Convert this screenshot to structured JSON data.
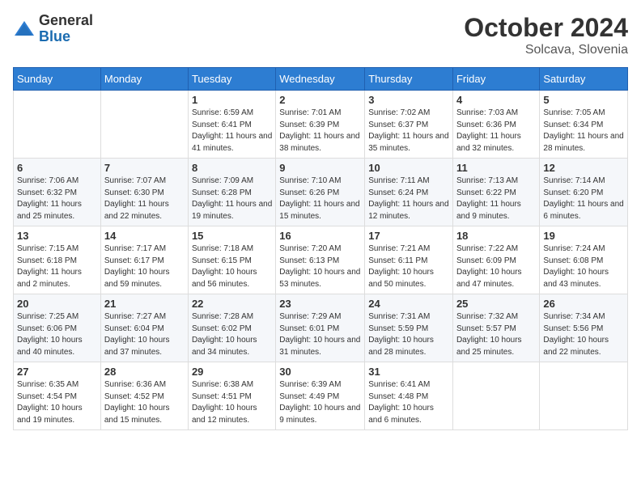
{
  "header": {
    "logo_general": "General",
    "logo_blue": "Blue",
    "month": "October 2024",
    "location": "Solcava, Slovenia"
  },
  "weekdays": [
    "Sunday",
    "Monday",
    "Tuesday",
    "Wednesday",
    "Thursday",
    "Friday",
    "Saturday"
  ],
  "weeks": [
    [
      {
        "day": "",
        "info": ""
      },
      {
        "day": "",
        "info": ""
      },
      {
        "day": "1",
        "info": "Sunrise: 6:59 AM\nSunset: 6:41 PM\nDaylight: 11 hours and 41 minutes."
      },
      {
        "day": "2",
        "info": "Sunrise: 7:01 AM\nSunset: 6:39 PM\nDaylight: 11 hours and 38 minutes."
      },
      {
        "day": "3",
        "info": "Sunrise: 7:02 AM\nSunset: 6:37 PM\nDaylight: 11 hours and 35 minutes."
      },
      {
        "day": "4",
        "info": "Sunrise: 7:03 AM\nSunset: 6:36 PM\nDaylight: 11 hours and 32 minutes."
      },
      {
        "day": "5",
        "info": "Sunrise: 7:05 AM\nSunset: 6:34 PM\nDaylight: 11 hours and 28 minutes."
      }
    ],
    [
      {
        "day": "6",
        "info": "Sunrise: 7:06 AM\nSunset: 6:32 PM\nDaylight: 11 hours and 25 minutes."
      },
      {
        "day": "7",
        "info": "Sunrise: 7:07 AM\nSunset: 6:30 PM\nDaylight: 11 hours and 22 minutes."
      },
      {
        "day": "8",
        "info": "Sunrise: 7:09 AM\nSunset: 6:28 PM\nDaylight: 11 hours and 19 minutes."
      },
      {
        "day": "9",
        "info": "Sunrise: 7:10 AM\nSunset: 6:26 PM\nDaylight: 11 hours and 15 minutes."
      },
      {
        "day": "10",
        "info": "Sunrise: 7:11 AM\nSunset: 6:24 PM\nDaylight: 11 hours and 12 minutes."
      },
      {
        "day": "11",
        "info": "Sunrise: 7:13 AM\nSunset: 6:22 PM\nDaylight: 11 hours and 9 minutes."
      },
      {
        "day": "12",
        "info": "Sunrise: 7:14 AM\nSunset: 6:20 PM\nDaylight: 11 hours and 6 minutes."
      }
    ],
    [
      {
        "day": "13",
        "info": "Sunrise: 7:15 AM\nSunset: 6:18 PM\nDaylight: 11 hours and 2 minutes."
      },
      {
        "day": "14",
        "info": "Sunrise: 7:17 AM\nSunset: 6:17 PM\nDaylight: 10 hours and 59 minutes."
      },
      {
        "day": "15",
        "info": "Sunrise: 7:18 AM\nSunset: 6:15 PM\nDaylight: 10 hours and 56 minutes."
      },
      {
        "day": "16",
        "info": "Sunrise: 7:20 AM\nSunset: 6:13 PM\nDaylight: 10 hours and 53 minutes."
      },
      {
        "day": "17",
        "info": "Sunrise: 7:21 AM\nSunset: 6:11 PM\nDaylight: 10 hours and 50 minutes."
      },
      {
        "day": "18",
        "info": "Sunrise: 7:22 AM\nSunset: 6:09 PM\nDaylight: 10 hours and 47 minutes."
      },
      {
        "day": "19",
        "info": "Sunrise: 7:24 AM\nSunset: 6:08 PM\nDaylight: 10 hours and 43 minutes."
      }
    ],
    [
      {
        "day": "20",
        "info": "Sunrise: 7:25 AM\nSunset: 6:06 PM\nDaylight: 10 hours and 40 minutes."
      },
      {
        "day": "21",
        "info": "Sunrise: 7:27 AM\nSunset: 6:04 PM\nDaylight: 10 hours and 37 minutes."
      },
      {
        "day": "22",
        "info": "Sunrise: 7:28 AM\nSunset: 6:02 PM\nDaylight: 10 hours and 34 minutes."
      },
      {
        "day": "23",
        "info": "Sunrise: 7:29 AM\nSunset: 6:01 PM\nDaylight: 10 hours and 31 minutes."
      },
      {
        "day": "24",
        "info": "Sunrise: 7:31 AM\nSunset: 5:59 PM\nDaylight: 10 hours and 28 minutes."
      },
      {
        "day": "25",
        "info": "Sunrise: 7:32 AM\nSunset: 5:57 PM\nDaylight: 10 hours and 25 minutes."
      },
      {
        "day": "26",
        "info": "Sunrise: 7:34 AM\nSunset: 5:56 PM\nDaylight: 10 hours and 22 minutes."
      }
    ],
    [
      {
        "day": "27",
        "info": "Sunrise: 6:35 AM\nSunset: 4:54 PM\nDaylight: 10 hours and 19 minutes."
      },
      {
        "day": "28",
        "info": "Sunrise: 6:36 AM\nSunset: 4:52 PM\nDaylight: 10 hours and 15 minutes."
      },
      {
        "day": "29",
        "info": "Sunrise: 6:38 AM\nSunset: 4:51 PM\nDaylight: 10 hours and 12 minutes."
      },
      {
        "day": "30",
        "info": "Sunrise: 6:39 AM\nSunset: 4:49 PM\nDaylight: 10 hours and 9 minutes."
      },
      {
        "day": "31",
        "info": "Sunrise: 6:41 AM\nSunset: 4:48 PM\nDaylight: 10 hours and 6 minutes."
      },
      {
        "day": "",
        "info": ""
      },
      {
        "day": "",
        "info": ""
      }
    ]
  ]
}
